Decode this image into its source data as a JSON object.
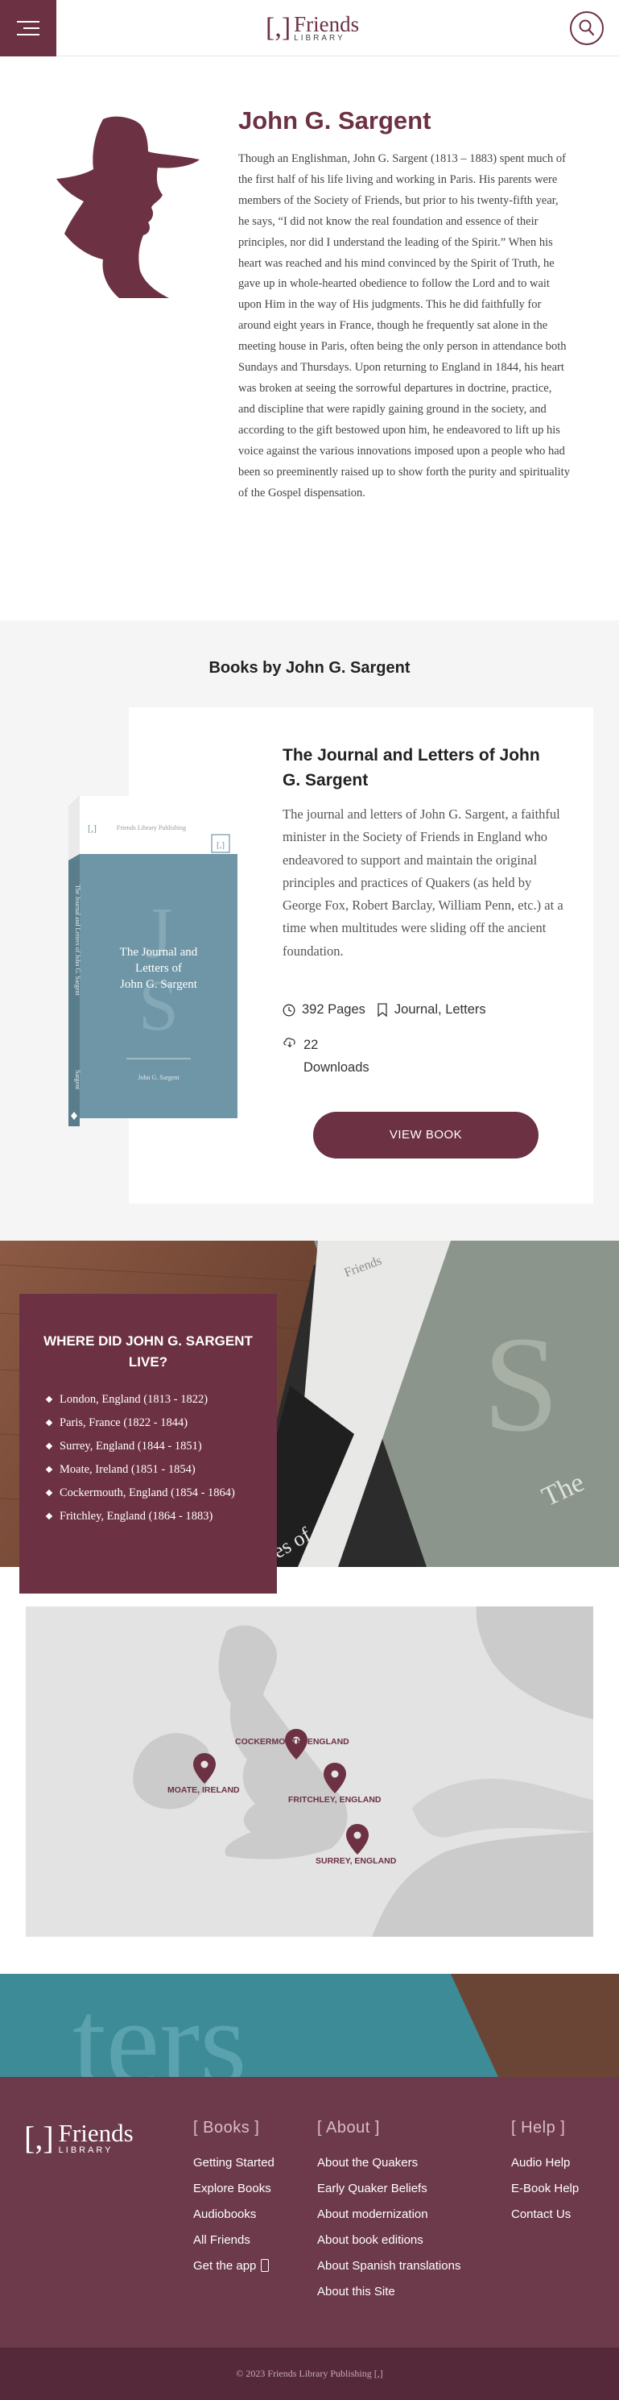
{
  "header": {
    "logo_bracket": "[,]",
    "logo_word": "Friends",
    "logo_sub": "LIBRARY"
  },
  "bio": {
    "name": "John G. Sargent",
    "text": "Though an Englishman, John G. Sargent (1813 – 1883) spent much of the first half of his life living and working in Paris. His parents were members of the Society of Friends, but prior to his twenty-fifth year, he says, “I did not know the real foundation and essence of their principles, nor did I understand the leading of the Spirit.” When his heart was reached and his mind convinced by the Spirit of Truth, he gave up in whole-hearted obedience to follow the Lord and to wait upon Him in the way of His judgments. This he did faithfully for around eight years in France, though he frequently sat alone in the meeting house in Paris, often being the only person in attendance both Sundays and Thursdays. Upon returning to England in 1844, his heart was broken at seeing the sorrowful departures in doctrine, practice, and discipline that were rapidly gaining ground in the society, and according to the gift bestowed upon him, he endeavored to lift up his voice against the various innovations imposed upon a people who had been so preeminently raised up to show forth the purity and spirituality of the Gospel dispensation."
  },
  "books": {
    "heading": "Books by John G. Sargent",
    "book": {
      "title": "The Journal and Letters of John G. Sargent",
      "description": "The journal and letters of John G. Sargent, a faithful minister in the Society of Friends in England who endeavored to support and maintain the original principles and practices of Quakers (as held by George Fox, Robert Barclay, William Penn, etc.) at a time when multitudes were sliding off the ancient foundation.",
      "pages": "392 Pages",
      "tags": "Journal, Letters",
      "downloads": "22 Downloads",
      "button": "VIEW BOOK",
      "cover": {
        "publisher": "Friends Library Publishing",
        "title_line1": "The Journal and",
        "title_line2": "Letters of",
        "title_line3": "John G. Sargent",
        "initial_1": "J",
        "initial_2": "S",
        "author": "John G. Sargent",
        "spine": "The Journal and Letters of John G. Sargent",
        "spine_author": "Sargent",
        "logo": "[,]"
      }
    }
  },
  "residences": {
    "title": "WHERE DID JOHN G. SARGENT LIVE?",
    "items": [
      "London, England (1813 - 1822)",
      "Paris, France (1822 - 1844)",
      "Surrey, England (1844 - 1851)",
      "Moate, Ireland (1851 - 1854)",
      "Cockermouth, England (1854 - 1864)",
      "Fritchley, England (1864 - 1883)"
    ],
    "map_pins": [
      "COCKERMOUTH, ENGLAND",
      "MOATE, IRELAND",
      "FRITCHLEY, ENGLAND",
      "SURREY, ENGLAND"
    ]
  },
  "photo_text": {
    "cover_edge": "Friends",
    "cover_big": "S",
    "cover_word": "The",
    "book_spine": "es of",
    "footer_word": "ters"
  },
  "footer": {
    "logo_bracket": "[,]",
    "logo_word": "Friends",
    "logo_sub": "LIBRARY",
    "books": {
      "heading": "[ Books ]",
      "links": [
        "Getting Started",
        "Explore Books",
        "Audiobooks",
        "All Friends",
        "Get the app"
      ]
    },
    "about": {
      "heading": "[ About ]",
      "links": [
        "About the Quakers",
        "Early Quaker Beliefs",
        "About modernization",
        "About book editions",
        "About Spanish translations",
        "About this Site"
      ]
    },
    "help": {
      "heading": "[ Help ]",
      "links": [
        "Audio Help",
        "E-Book Help",
        "Contact Us"
      ]
    },
    "copyright": "© 2023 Friends Library Publishing [,]"
  },
  "colors": {
    "brand": "#6c3142",
    "cover_blue": "#6f96a6",
    "footer_bg": "#6c3a4b",
    "section_bg": "#f5f5f5"
  }
}
